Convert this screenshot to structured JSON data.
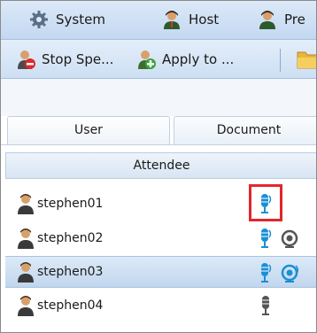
{
  "menu": {
    "items": [
      {
        "label": "System",
        "icon": "gear-icon"
      },
      {
        "label": "Host",
        "icon": "user-icon"
      },
      {
        "label": "Pre",
        "icon": "user-icon"
      }
    ]
  },
  "toolbar": {
    "stop_label": "Stop Spe...",
    "apply_label": "Apply to ..."
  },
  "tabs": {
    "user": "User",
    "document": "Document"
  },
  "list": {
    "header": "Attendee",
    "rows": [
      {
        "name": "stephen01",
        "mic": "speaking",
        "camera": false,
        "selected": false
      },
      {
        "name": "stephen02",
        "mic": "speaking",
        "camera": true,
        "selected": false
      },
      {
        "name": "stephen03",
        "mic": "speaking",
        "camera": true,
        "selected": true
      },
      {
        "name": "stephen04",
        "mic": "muted",
        "camera": false,
        "selected": false
      }
    ]
  },
  "colors": {
    "mic_active": "#1a8fd6",
    "mic_muted": "#555555",
    "highlight": "#e3262b",
    "selection": "#c1d6ee"
  }
}
